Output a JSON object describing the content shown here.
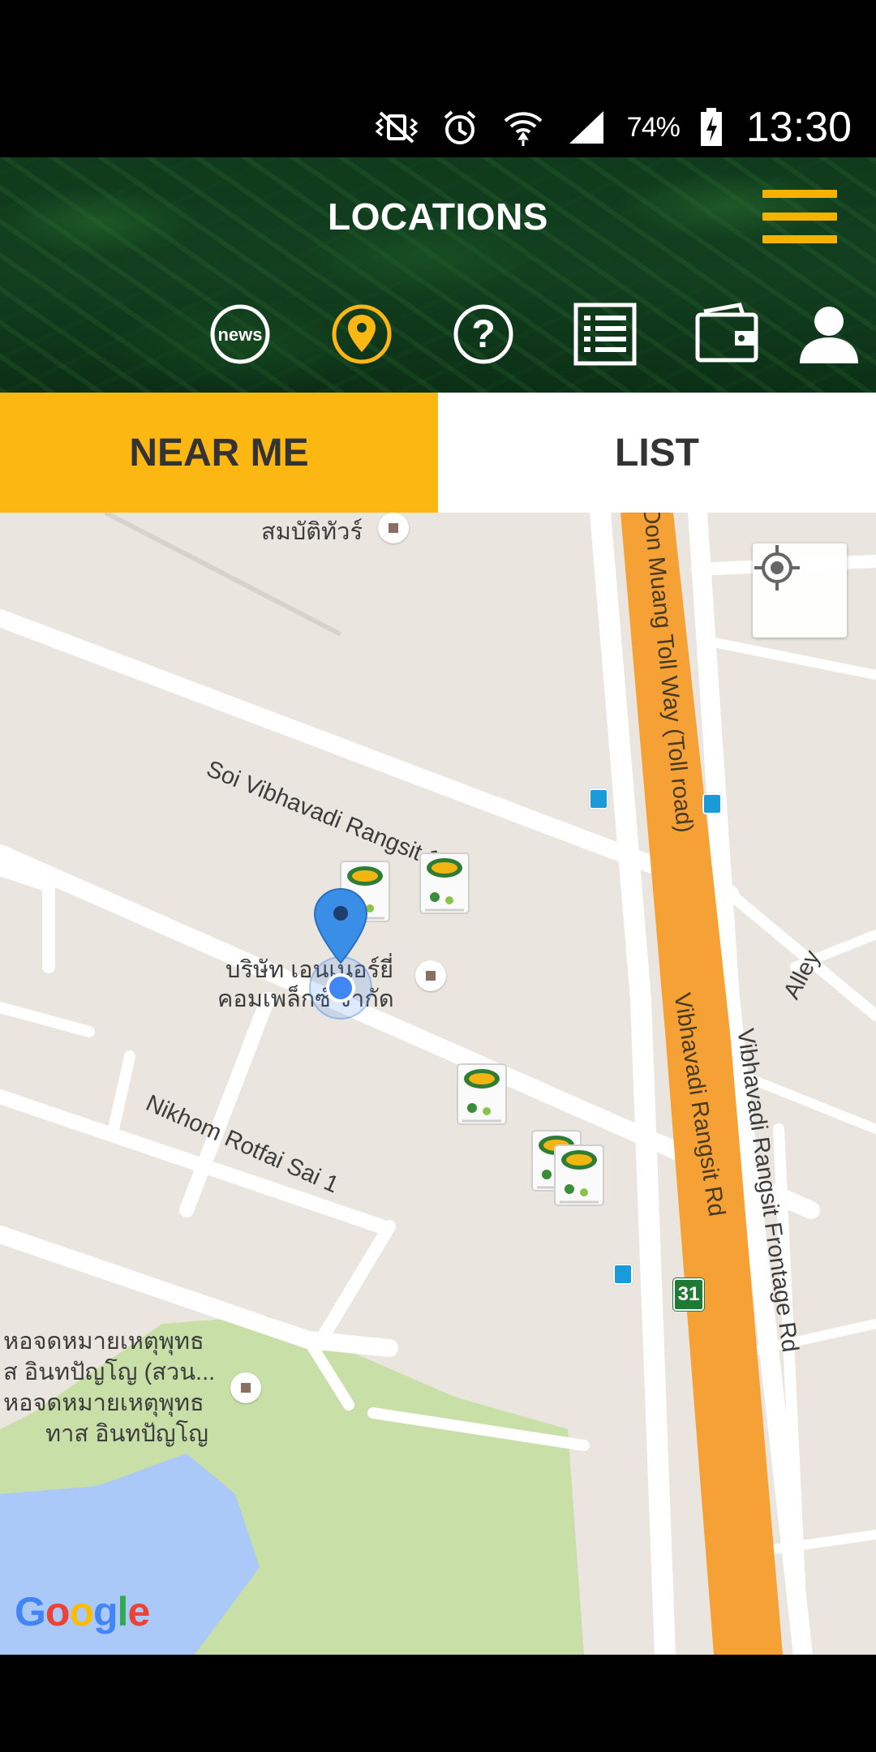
{
  "status_bar": {
    "battery": "74%",
    "time": "13:30",
    "icons": [
      "vibrate-mute-icon",
      "alarm-icon",
      "wifi-icon",
      "signal-icon",
      "battery-charging-icon"
    ]
  },
  "header": {
    "title": "LOCATIONS",
    "menu_icon": "hamburger-menu-icon",
    "nav": [
      {
        "name": "news",
        "label": "news",
        "icon": "news-icon",
        "active": false
      },
      {
        "name": "locations",
        "label": "",
        "icon": "location-pin-icon",
        "active": true
      },
      {
        "name": "help",
        "label": "?",
        "icon": "question-icon",
        "active": false
      },
      {
        "name": "list",
        "label": "",
        "icon": "list-icon",
        "active": false
      },
      {
        "name": "wallet",
        "label": "",
        "icon": "wallet-icon",
        "active": false
      },
      {
        "name": "profile",
        "label": "",
        "icon": "user-icon",
        "active": false
      }
    ]
  },
  "tabs": {
    "near_me": "NEAR ME",
    "list": "LIST",
    "active": "near_me"
  },
  "map": {
    "labels": {
      "top_poi": "สมบัติทัวร์",
      "soi_vibhavadi": "Soi Vibhavadi Rangsit 1",
      "company_line1": "บริษัท เอนเนอร์ยี่",
      "company_line2": "คอมเพล็กซ์ จำกัด",
      "nikhom": "Nikhom Rotfai Sai 1",
      "library_line1": "หอจดหมายเหตุพุทธ",
      "library_line2": "ส อินทปัญโญ (สวน...",
      "library_line3": "หอจดหมายเหตุพุทธ",
      "library_line4": "ทาส อินทปัญโญ",
      "tollway": "Don Muang Toll Way (Toll road)",
      "vibhavadi_rd": "Vibhavadi Rangsit Rd",
      "frontage_rd": "Vibhavadi Rangsit Frontage Rd",
      "alley": "Alley",
      "route_number": "31",
      "google": "Google"
    },
    "colors": {
      "background": "#eae6df",
      "road": "#ffffff",
      "toll": "#f6a136",
      "park": "#c8dfa8",
      "water": "#aac8f8",
      "accent": "#fcb713",
      "header_green": "#123f1f"
    }
  }
}
